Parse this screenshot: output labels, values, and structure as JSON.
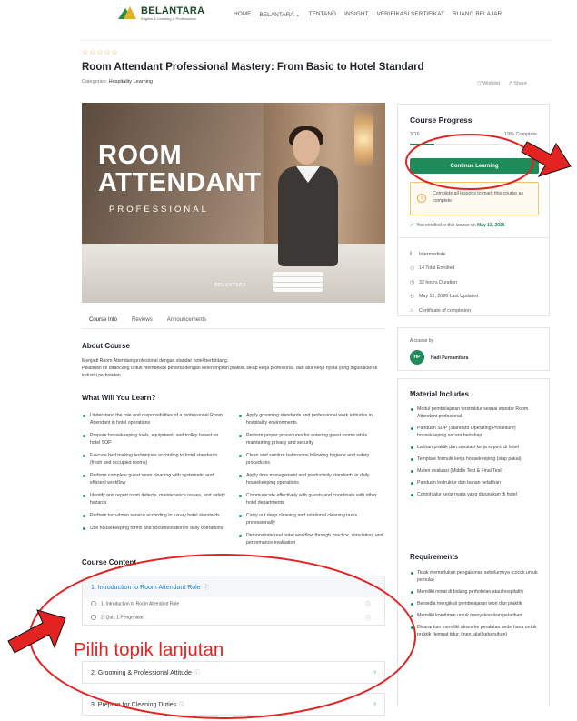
{
  "header": {
    "brand": "BELANTARA",
    "brand_sub": "English & Learning & Professional",
    "nav": [
      "HOME",
      "BELANTARA ⌄",
      "TENTANG",
      "INSIGHT",
      "VERIFIKASI SERTIFIKAT",
      "RUANG BELAJAR"
    ]
  },
  "course": {
    "rating_stars": "☆☆☆☆☆",
    "title": "Room Attendant Professional Mastery: From Basic to Hotel Standard",
    "categories_label": "Categories:",
    "category": "Hospitality Learning",
    "wishlist": "Wishlist",
    "share": "Share"
  },
  "hero": {
    "line1": "ROOM",
    "line2": "ATTENDANT",
    "line3": "PROFESSIONAL",
    "brand": "BELANTARA"
  },
  "tabs": [
    "Course Info",
    "Reviews",
    "Announcements"
  ],
  "about": {
    "heading": "About Course",
    "line1": "Menjadi Room Attendant profesional dengan standar hotel berbintang.",
    "line2": "Pelatihan ini dirancang untuk membekali peserta dengan keterampilan praktis, sikap kerja profesional, dan alur kerja nyata yang digunakan di industri perhotelan."
  },
  "learn": {
    "heading": "What Will You Learn?",
    "left": [
      "Understand the role and responsibilities of a professional Room Attendant in hotel operations",
      "Prepare housekeeping tools, equipment, and trolley based on hotel SOP",
      "Execute bed making techniques according to hotel standards (fresh and occupied rooms)",
      "Perform complete guest room cleaning with systematic and efficient workflow",
      "Identify and report room defects, maintenance issues, and safety hazards",
      "Perform turn-down service according to luxury hotel standards",
      "Use housekeeping forms and documentation in daily operations"
    ],
    "right": [
      "Apply grooming standards and professional work attitudes in hospitality environments",
      "Perform proper procedures for entering guest rooms while maintaining privacy and security",
      "Clean and sanitize bathrooms following hygiene and safety procedures",
      "Apply time management and productivity standards in daily housekeeping operations",
      "Communicate effectively with guests and coordinate with other hotel departments",
      "Carry out deep cleaning and rotational cleaning tasks professionally",
      "Demonstrate real hotel workflow through practice, simulation, and performance evaluation"
    ]
  },
  "content": {
    "heading": "Course Content",
    "topics": [
      {
        "title": "1. Introduction to Room Attendant Role",
        "lessons": [
          "1. Introduction to Room Attendant Role",
          "2. Quiz 1 Pengenalan"
        ]
      },
      {
        "title": "2. Grooming & Professional Attitude",
        "lessons": []
      },
      {
        "title": "3. Prepare for Cleaning Duties",
        "lessons": []
      }
    ]
  },
  "progress": {
    "heading": "Course Progress",
    "count": "3/16",
    "percent_label": "19% Complete",
    "percent": 19,
    "continue_label": "Continue Learning",
    "notice": "Complete all lessons to mark this course as complete",
    "enrolled_text": "You enrolled in this course on",
    "enrolled_date": "May 13, 2026",
    "meta": [
      {
        "icon": "level-icon",
        "glyph": "‖",
        "text": "Intermediate"
      },
      {
        "icon": "students-icon",
        "glyph": "⚇",
        "text": "14 Total Enrolled"
      },
      {
        "icon": "clock-icon",
        "glyph": "◷",
        "text": "32 hours Duration"
      },
      {
        "icon": "refresh-icon",
        "glyph": "↻",
        "text": "May 12, 2026 Last Updated"
      },
      {
        "icon": "certificate-icon",
        "glyph": "⌂",
        "text": "Certificate of completion"
      }
    ]
  },
  "author": {
    "label": "A course by",
    "initials": "HP",
    "name": "Hadi Purnamitara"
  },
  "materials": {
    "heading": "Material Includes",
    "items": [
      "Modul pembelajaran terstruktur sesuai standar Room Attendant profesional",
      "Panduan SOP (Standard Operating Procedure) housekeeping secara bertahap",
      "Latihan praktik dan simulasi kerja seperti di hotel",
      "Template formulir kerja housekeeping (siap pakai)",
      "Materi evaluasi (Middle Test & Final Test)",
      "Panduan instruktur dan bahan pelatihan",
      "Contoh alur kerja nyata yang digunakan di hotel"
    ]
  },
  "requirements": {
    "heading": "Requirements",
    "items": [
      "Tidak memerlukan pengalaman sebelumnya (cocok untuk pemula)",
      "Memiliki minat di bidang perhotelan atau hospitality",
      "Bersedia mengikuti pembelajaran teori dan praktik",
      "Memiliki komitmen untuk menyelesaikan pelatihan",
      "Disarankan memiliki akses ke peralatan sederhana untuk praktik (tempat tidur, linen, alat kebersihan)"
    ]
  },
  "annotation": {
    "caption": "Pilih topik lanjutan",
    "color": "#e32222"
  }
}
